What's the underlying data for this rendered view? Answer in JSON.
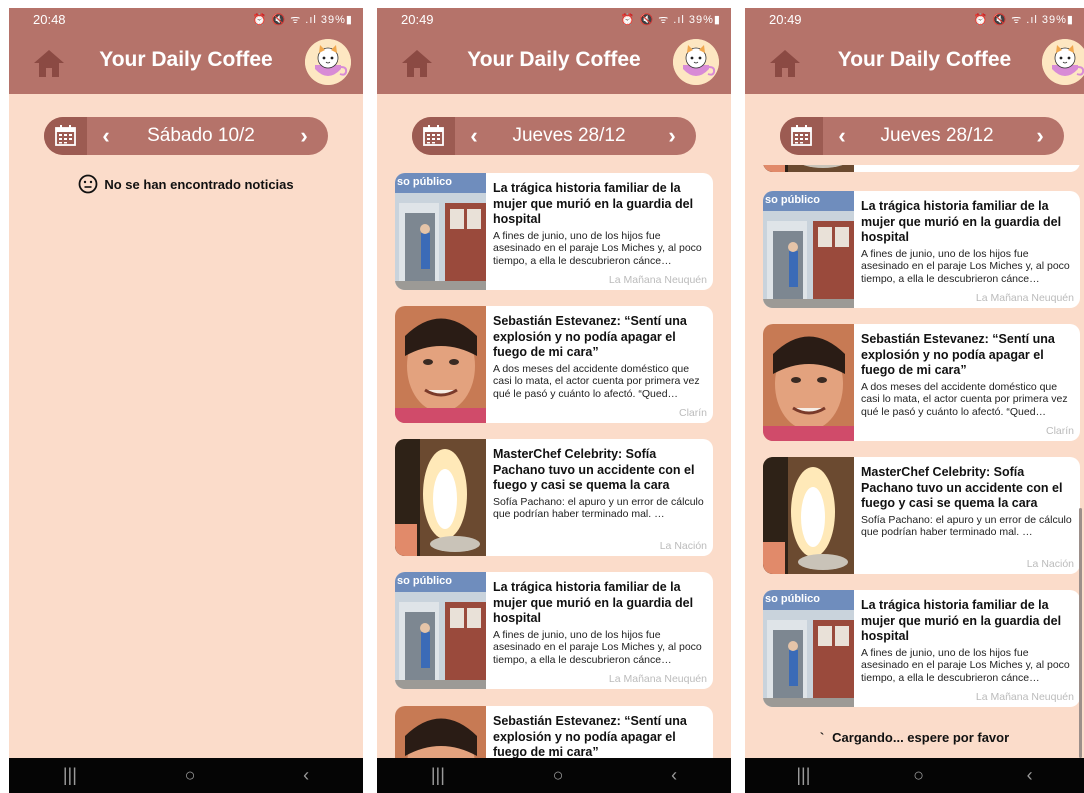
{
  "app_title": "Your Daily Coffee",
  "icons": {
    "home": "home-icon",
    "avatar": "coffee-cat-icon",
    "calendar": "calendar-icon",
    "prev": "chevron-left-icon",
    "next": "chevron-right-icon",
    "neutral": "neutral-face-icon"
  },
  "colors": {
    "primary": "#b5736a",
    "primary_dark": "#9c5b52",
    "background": "#fbdcca"
  },
  "screens": [
    {
      "status_time": "20:48",
      "status_right": "⏰ 🔇 ᯤ .ıl 39%▮",
      "date": "Sábado 10/2",
      "empty_message": "No se han encontrado noticias",
      "nav": [
        "|||",
        "○",
        "‹"
      ]
    },
    {
      "status_time": "20:49",
      "status_right": "⏰ 🔇 ᯤ .ıl 39%▮",
      "date": "Jueves 28/12",
      "nav": [
        "|||",
        "○",
        "‹"
      ]
    },
    {
      "status_time": "20:49",
      "status_right": "⏰ 🔇 ᯤ .ıl 39%▮",
      "date": "Jueves 28/12",
      "loading": "Cargando... espere por favor",
      "nav": [
        "|||",
        "○",
        "‹"
      ]
    }
  ],
  "articles": [
    {
      "title": "La trágica historia familiar de la mujer que murió en la guardia del hospital",
      "description": "A fines de junio, uno de los hijos fue asesinado en el paraje Los Miches y, al poco tiempo, a ella le descubrieron cánce…",
      "source": "La Mañana Neuquén",
      "thumb_text": "so público"
    },
    {
      "title": "Sebastián Estevanez: “Sentí una explosión y no podía apagar el fuego de mi cara”",
      "description": "A dos meses del accidente doméstico que casi lo mata, el actor cuenta por primera vez qué le pasó y cuánto lo afectó. “Qued…",
      "source": "Clarín"
    },
    {
      "title": "MasterChef Celebrity: Sofía Pachano tuvo un accidente con el fuego y casi se quema la cara",
      "description": "Sofía Pachano: el apuro y un error de cálculo que podrían haber terminado mal. …",
      "source": "La Nación"
    },
    {
      "title": "La trágica historia familiar de la mujer que murió en la guardia del hospital",
      "description": "A fines de junio, uno de los hijos fue asesinado en el paraje Los Miches y, al poco tiempo, a ella le descubrieron cánce…",
      "source": "La Mañana Neuquén",
      "thumb_text": "so público"
    },
    {
      "title": "Sebastián Estevanez: “Sentí una explosión y no podía apagar el fuego de mi cara”",
      "description": "",
      "source": ""
    }
  ]
}
